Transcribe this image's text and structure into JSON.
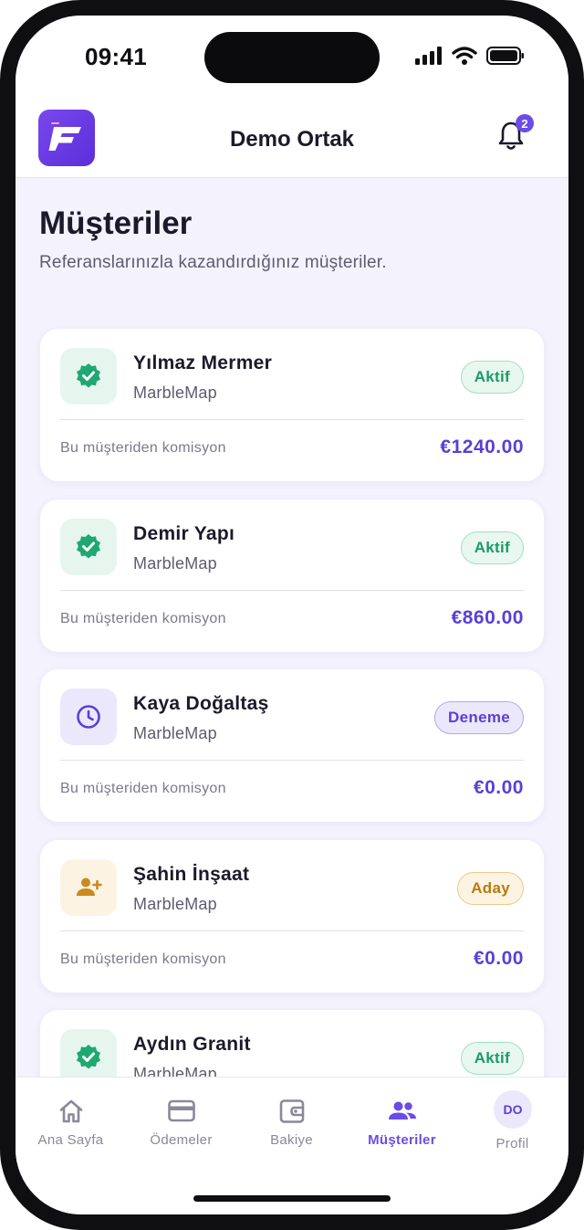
{
  "status_bar": {
    "time": "09:41"
  },
  "header": {
    "title": "Demo Ortak",
    "notification_count": "2"
  },
  "page": {
    "title": "Müşteriler",
    "subtitle": "Referanslarınızla kazandırdığınız müşteriler."
  },
  "clients": [
    {
      "name": "Yılmaz Mermer",
      "product": "MarbleMap",
      "status": "Aktif",
      "commission_label": "Bu müşteriden komisyon",
      "commission": "€1240.00",
      "icon": "verified-badge-icon"
    },
    {
      "name": "Demir Yapı",
      "product": "MarbleMap",
      "status": "Aktif",
      "commission_label": "Bu müşteriden komisyon",
      "commission": "€860.00",
      "icon": "verified-badge-icon"
    },
    {
      "name": "Kaya Doğaltaş",
      "product": "MarbleMap",
      "status": "Deneme",
      "commission_label": "Bu müşteriden komisyon",
      "commission": "€0.00",
      "icon": "clock-icon"
    },
    {
      "name": "Şahin İnşaat",
      "product": "MarbleMap",
      "status": "Aday",
      "commission_label": "Bu müşteriden komisyon",
      "commission": "€0.00",
      "icon": "person-add-icon"
    },
    {
      "name": "Aydın Granit",
      "product": "MarbleMap",
      "status": "Aktif",
      "icon": "verified-badge-icon"
    }
  ],
  "bottom_nav": {
    "items": [
      {
        "label": "Ana Sayfa",
        "icon": "home-icon"
      },
      {
        "label": "Ödemeler",
        "icon": "credit-card-icon"
      },
      {
        "label": "Bakiye",
        "icon": "wallet-icon"
      },
      {
        "label": "Müşteriler",
        "icon": "users-icon",
        "active": true
      },
      {
        "label": "Profil",
        "avatar_initials": "DO"
      }
    ]
  },
  "colors": {
    "accent": "#6b4ce6",
    "active_green": "#1c9a67",
    "trial_purple": "#5b3fd4",
    "lead_orange": "#b77a12",
    "background": "#f4f2fd"
  }
}
